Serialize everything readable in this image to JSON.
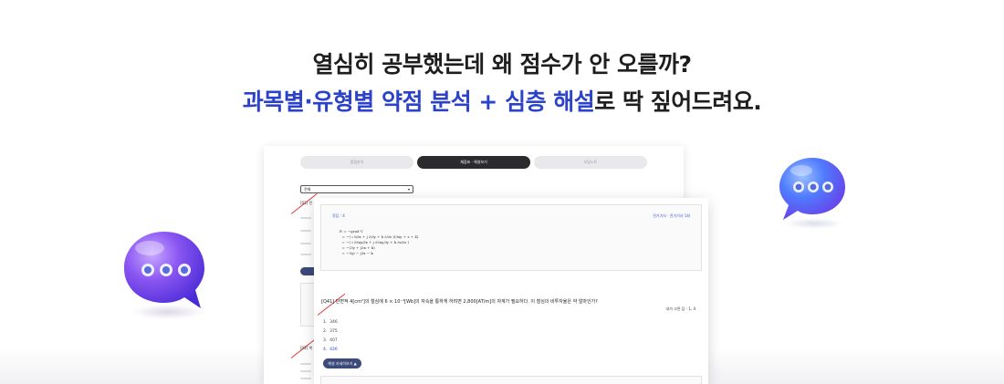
{
  "headline": {
    "line1": "열심히 공부했는데 왜 점수가 안 오를까?",
    "line2_accent_1": "과목별·유형별 약점 분석",
    "line2_plus": " + ",
    "line2_accent_2": "심층 해설",
    "line2_rest": "로 딱 짚어드려요."
  },
  "colors": {
    "accent": "#2c43c9",
    "active_tab": "#2b2b2e",
    "button": "#3b4a7a",
    "bubble_purple": "#7b4cf0",
    "bubble_blue": "#3d6bff",
    "wrong_mark": "#e03a3a"
  },
  "back_page": {
    "tabs": [
      "종합분석",
      "채점표 · 해설보기",
      "오답노트"
    ],
    "active_tab_index": 1,
    "select_value": "전체",
    "q1": "[01] 전",
    "q2": "[02] 복"
  },
  "front_page": {
    "answer_label": "정답 : 4",
    "answer_meta": "전기기사 · 전기기사 1회",
    "formula": "E = −grad V\n  = −( i ∂/∂x + j ∂/∂y + k ∂/∂z )(3xy + z + 4)\n  = −( i ∂3xy/∂x + j ∂3xy/∂y + k ∂z/∂z )\n  = −(3y + j3x + k)\n  = −3yi − j3x − k",
    "question": "[Q41] 단면적 4[cm²]의 철심에 6 × 10⁻⁴[Wb]의 자속을 통하게 하려면 2,800[AT/m]의 자계가 필요하다. 이 철심의 비투자율은 약 얼마인가?",
    "correct_rate": "내가 고른 답 : 1, 4",
    "choices": [
      {
        "num": "1.",
        "text": "346"
      },
      {
        "num": "2.",
        "text": "375"
      },
      {
        "num": "3.",
        "text": "407"
      },
      {
        "num": "4.",
        "text": "426"
      }
    ],
    "selected_choice_index": 3,
    "explain_button": "해설 자세히보기 ▲"
  },
  "icons": {
    "left_bubble": "chat-bubble-dots-icon",
    "right_bubble": "chat-bubble-dots-icon"
  }
}
